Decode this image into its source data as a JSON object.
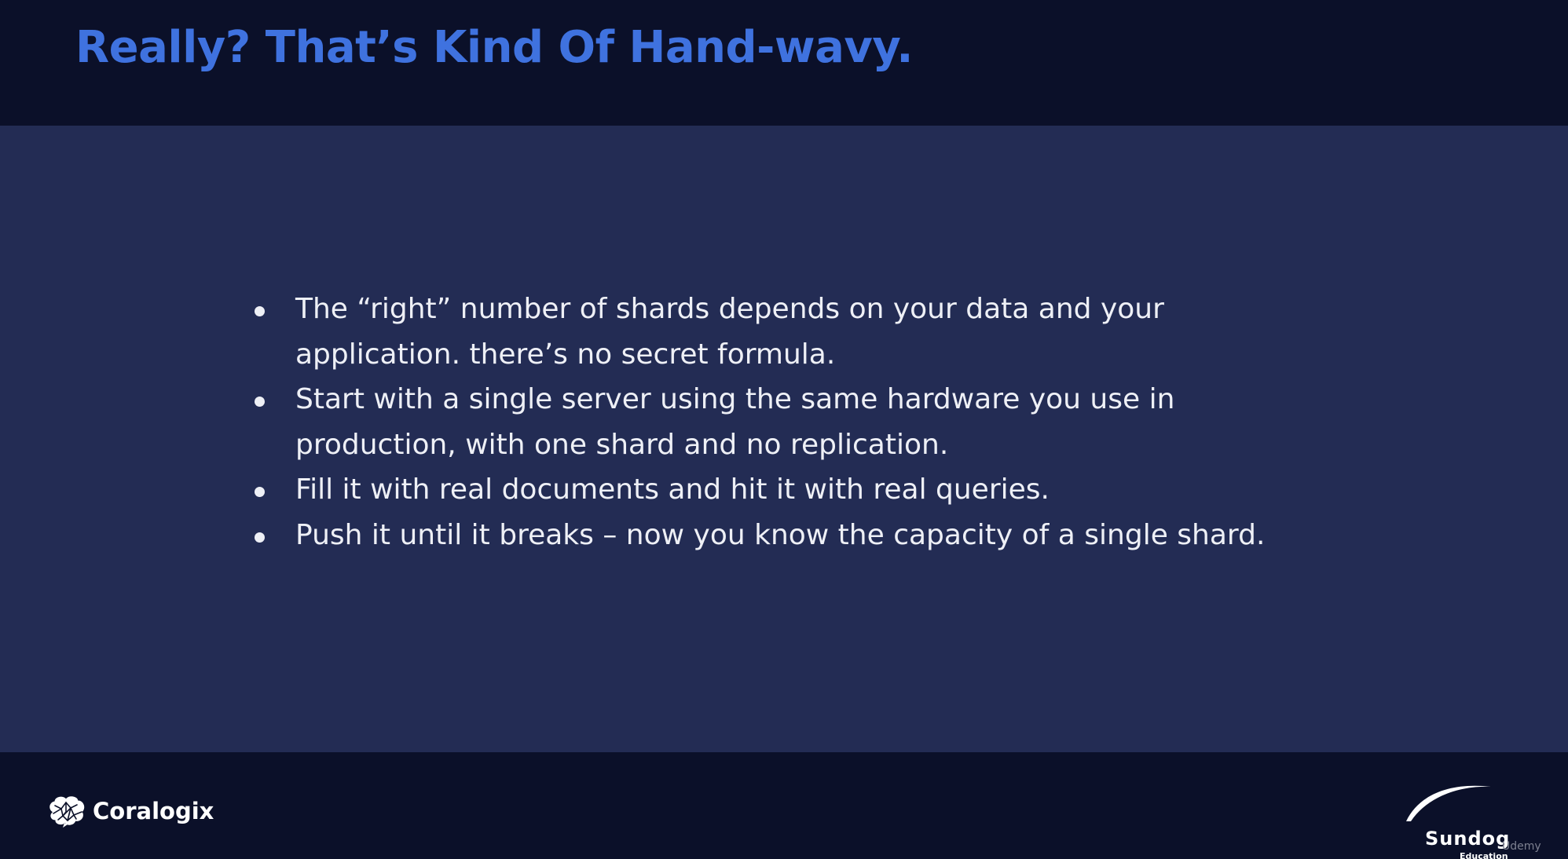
{
  "slide": {
    "title": "Really? That’s Kind Of Hand-wavy.",
    "bullets": [
      {
        "lines": [
          "The “right” number of shards depends on your data and your",
          "application. there’s no secret formula."
        ]
      },
      {
        "lines": [
          "Start with a single server using the same hardware you use in",
          "production, with one shard and no replication."
        ]
      },
      {
        "lines": [
          "Fill it with real documents and hit it with real queries."
        ]
      },
      {
        "lines": [
          "Push it until it breaks – now you know the capacity of a single shard."
        ]
      }
    ]
  },
  "footer": {
    "left_logo": {
      "icon": "brain-icon",
      "name": "Coralogix"
    },
    "right_logo": {
      "name": "Sundog",
      "subtitle": "Education"
    },
    "watermark": "Udemy"
  },
  "colors": {
    "header_bg": "#0b1029",
    "content_bg": "#232c54",
    "title": "#3f72df",
    "text": "#eef0f6"
  }
}
